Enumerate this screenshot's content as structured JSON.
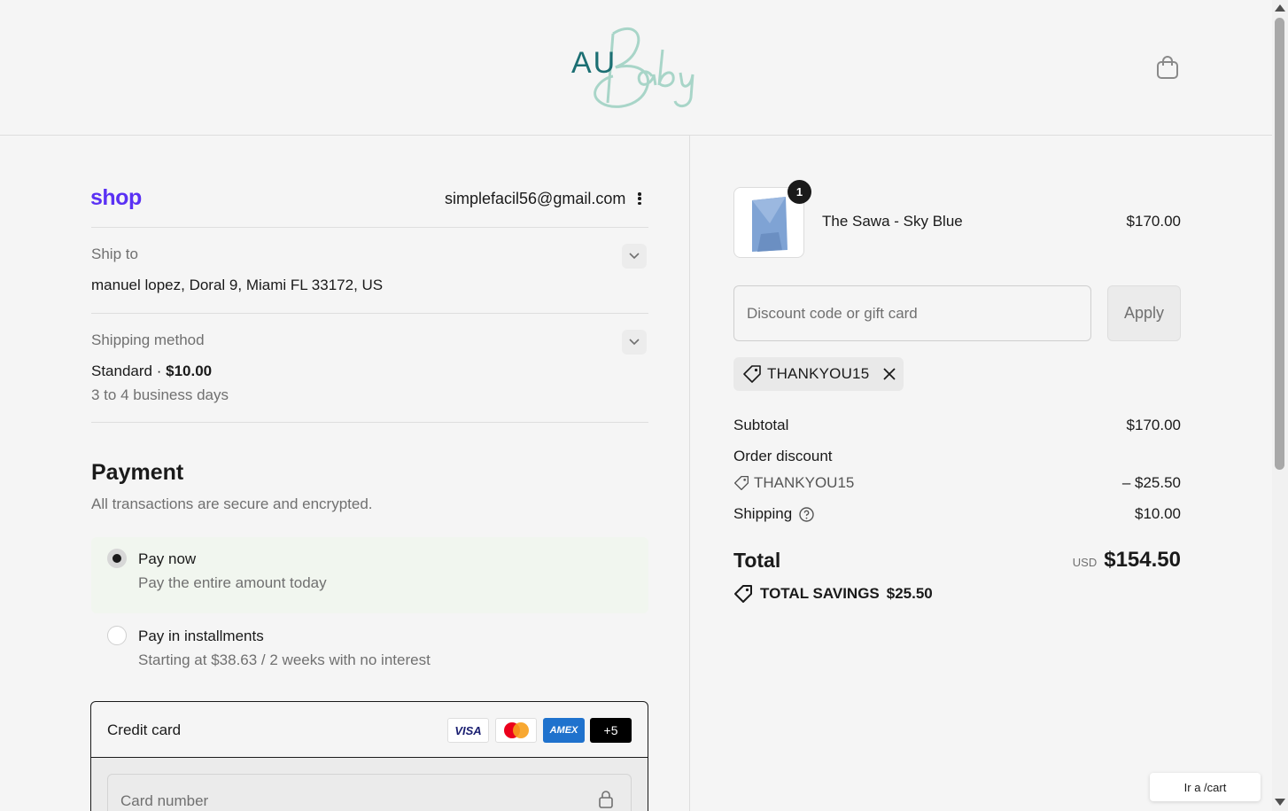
{
  "header": {
    "logo_text": "AU",
    "logo_script": "Baby",
    "cart_icon": "shopping-bag-icon"
  },
  "shop_pay": {
    "logo": "shop",
    "email": "simplefacil56@gmail.com"
  },
  "ship_to": {
    "label": "Ship to",
    "value": "manuel lopez, Doral 9, Miami FL 33172, US"
  },
  "shipping_method": {
    "label": "Shipping method",
    "name": "Standard",
    "separator": " · ",
    "price": "$10.00",
    "eta": "3 to 4 business days"
  },
  "payment": {
    "title": "Payment",
    "subtitle": "All transactions are secure and encrypted.",
    "options": [
      {
        "label": "Pay now",
        "sub": "Pay the entire amount today",
        "selected": true
      },
      {
        "label": "Pay in installments",
        "sub": "Starting at $38.63 / 2 weeks with no interest",
        "selected": false
      }
    ],
    "credit_card": {
      "label": "Credit card",
      "logos": [
        "VISA",
        "mastercard",
        "AMEX",
        "+5"
      ],
      "card_number_placeholder": "Card number"
    }
  },
  "order": {
    "product": {
      "name": "The Sawa - Sky Blue",
      "price": "$170.00",
      "quantity": "1"
    },
    "discount": {
      "placeholder": "Discount code or gift card",
      "apply_label": "Apply",
      "applied_code": "THANKYOU15"
    },
    "summary": {
      "subtotal_label": "Subtotal",
      "subtotal": "$170.00",
      "order_discount_label": "Order discount",
      "discount_code": "THANKYOU15",
      "discount_amount": "– $25.50",
      "shipping_label": "Shipping",
      "shipping": "$10.00",
      "total_label": "Total",
      "currency": "USD",
      "total": "$154.50",
      "savings_label": "TOTAL SAVINGS",
      "savings": "$25.50"
    }
  },
  "status_tooltip": "Ir a /cart",
  "colors": {
    "shop_purple": "#5a31f4",
    "logo_teal": "#1c6f73",
    "logo_mint": "#a8d5c8",
    "selected_bg": "#f1f6ef"
  }
}
